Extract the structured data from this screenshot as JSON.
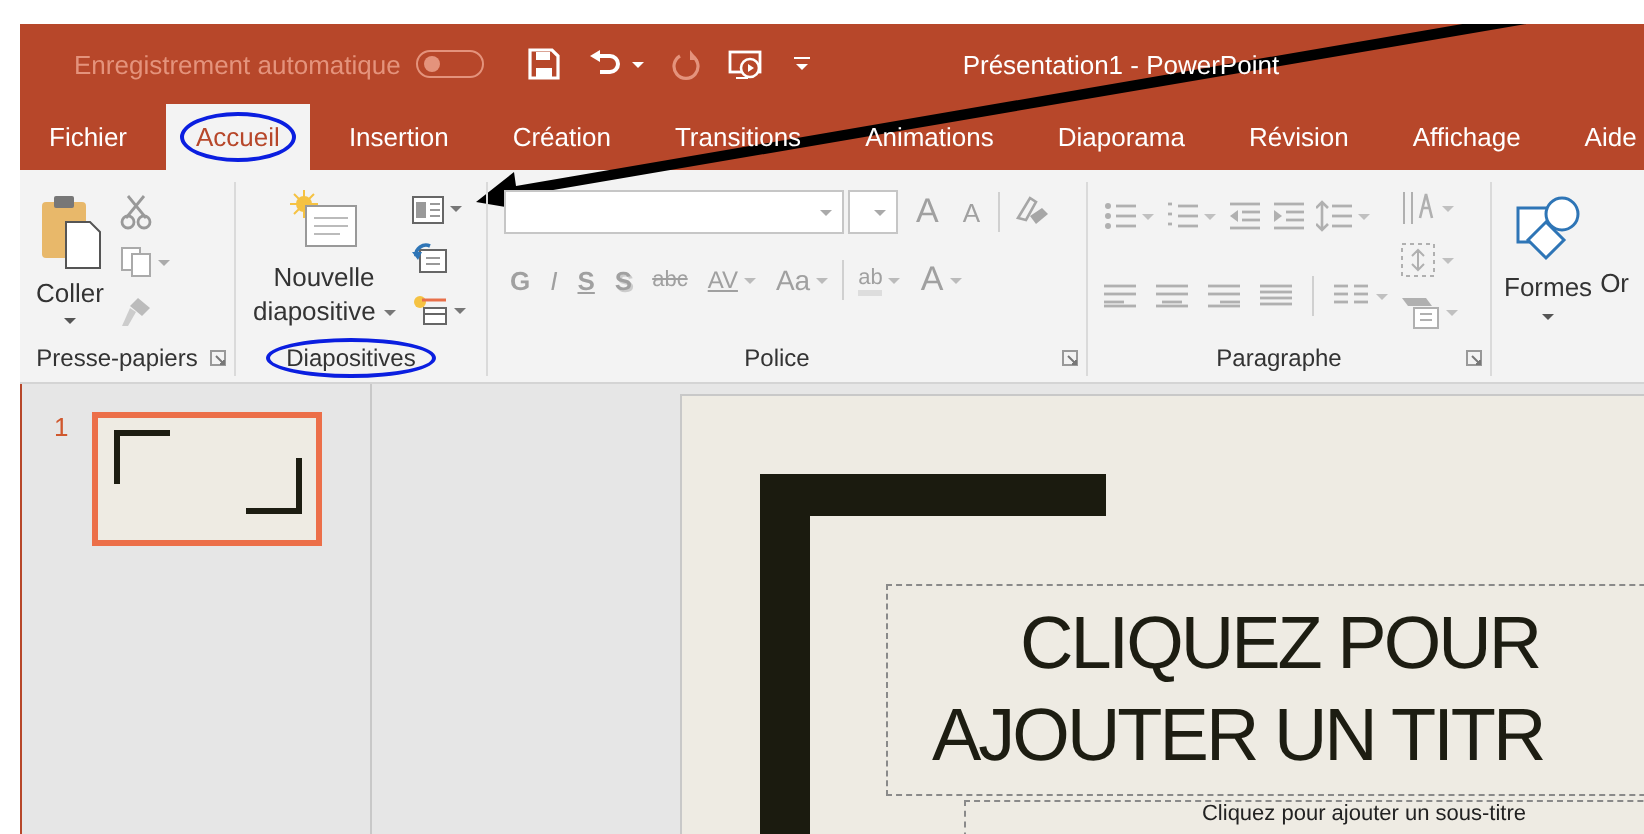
{
  "title_bar": {
    "autosave_label": "Enregistrement automatique",
    "autosave_on": false,
    "title": "Présentation1 - PowerPoint"
  },
  "tabs": [
    {
      "label": "Fichier",
      "selected": false,
      "circled": false
    },
    {
      "label": "Accueil",
      "selected": true,
      "circled": true
    },
    {
      "label": "Insertion",
      "selected": false,
      "circled": false
    },
    {
      "label": "Création",
      "selected": false,
      "circled": false
    },
    {
      "label": "Transitions",
      "selected": false,
      "circled": false
    },
    {
      "label": "Animations",
      "selected": false,
      "circled": false
    },
    {
      "label": "Diaporama",
      "selected": false,
      "circled": false
    },
    {
      "label": "Révision",
      "selected": false,
      "circled": false
    },
    {
      "label": "Affichage",
      "selected": false,
      "circled": false
    },
    {
      "label": "Aide",
      "selected": false,
      "circled": false
    }
  ],
  "ribbon": {
    "clipboard": {
      "label": "Presse-papiers",
      "circled": false,
      "paste": "Coller"
    },
    "slides": {
      "label": "Diapositives",
      "circled": true,
      "new_slide": "Nouvelle diapositive"
    },
    "font": {
      "label": "Police",
      "circled": false,
      "disabled": true,
      "grow": "A",
      "shrink": "A",
      "format_buttons": [
        "G",
        "I",
        "S",
        "S",
        "abc",
        "AV",
        "Aa"
      ],
      "highlight": "ab",
      "font_color": "A"
    },
    "paragraph": {
      "label": "Paragraphe",
      "circled": false,
      "disabled": true
    },
    "drawing": {
      "shapes": "Formes",
      "arrange": "Or"
    }
  },
  "slide_panel": {
    "slides": [
      {
        "number": "1",
        "selected": true
      }
    ]
  },
  "slide": {
    "title_lines": [
      "CLIQUEZ POUR",
      "AJOUTER UN TITR"
    ],
    "subtitle": "Cliquez pour ajouter un sous-titre"
  }
}
